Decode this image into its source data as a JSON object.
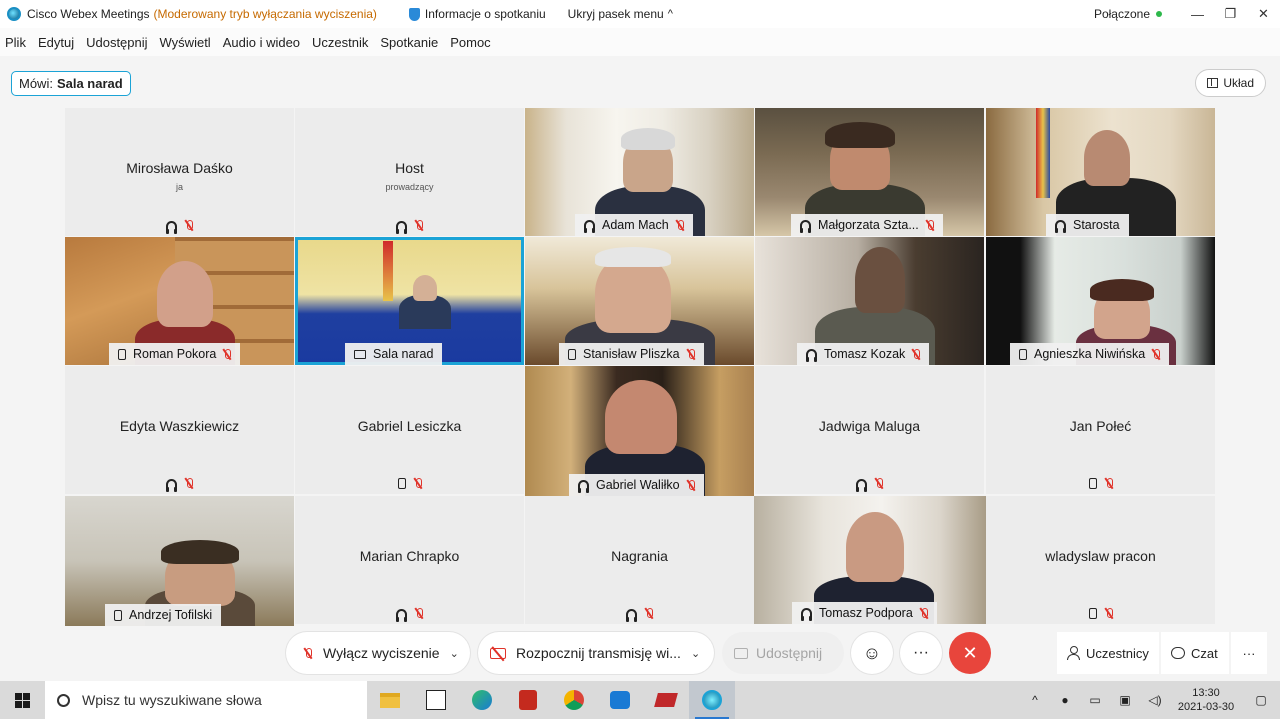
{
  "window": {
    "app_title": "Cisco Webex Meetings",
    "mode": "(Moderowany tryb wyłączania wyciszenia)",
    "meeting_info": "Informacje o spotkaniu",
    "hide_menu": "Ukryj pasek menu",
    "hide_menu_chevron": "^",
    "status": "Połączone",
    "minimize": "—",
    "restore": "❐",
    "close": "✕"
  },
  "menu": [
    "Plik",
    "Edytuj",
    "Udostępnij",
    "Wyświetl",
    "Audio i wideo",
    "Uczestnik",
    "Spotkanie",
    "Pomoc"
  ],
  "speaking": {
    "label": "Mówi:",
    "name": "Sala narad"
  },
  "layout_button": "Układ",
  "participants": [
    {
      "name": "Mirosława Daśko",
      "role": "ja",
      "video": false,
      "audio": "headset"
    },
    {
      "name": "Host",
      "role": "prowadzący",
      "video": false,
      "audio": "headset"
    },
    {
      "name": "Adam Mach",
      "video": true,
      "audio": "headset"
    },
    {
      "name": "Małgorzata Szta...",
      "video": true,
      "audio": "headset"
    },
    {
      "name": "Starosta",
      "video": true,
      "audio": "headset"
    },
    {
      "name": "Roman Pokora",
      "video": true,
      "audio": "phone"
    },
    {
      "name": "Sala narad",
      "video": true,
      "audio": "room",
      "active": true
    },
    {
      "name": "Stanisław Pliszka",
      "video": true,
      "audio": "phone"
    },
    {
      "name": "Tomasz Kozak",
      "video": true,
      "audio": "headset"
    },
    {
      "name": "Agnieszka Niwińska",
      "video": true,
      "audio": "phone"
    },
    {
      "name": "Edyta Waszkiewicz",
      "video": false,
      "audio": "headset"
    },
    {
      "name": "Gabriel Lesiczka",
      "video": false,
      "audio": "phone"
    },
    {
      "name": "Gabriel Waliłko",
      "video": true,
      "audio": "headset"
    },
    {
      "name": "Jadwiga Maluga",
      "video": false,
      "audio": "headset"
    },
    {
      "name": "Jan Połeć",
      "video": false,
      "audio": "phone"
    },
    {
      "name": "Andrzej Tofilski",
      "video": true,
      "audio": "phone"
    },
    {
      "name": "Marian Chrapko",
      "video": false,
      "audio": "headset"
    },
    {
      "name": "Nagrania",
      "video": false,
      "audio": "headset"
    },
    {
      "name": "Tomasz Podpora",
      "video": true,
      "audio": "headset"
    },
    {
      "name": "wladyslaw pracon",
      "video": false,
      "audio": "phone"
    }
  ],
  "controls": {
    "unmute": "Wyłącz wyciszenie",
    "start_video": "Rozpocznij transmisję wi...",
    "share": "Udostępnij",
    "reactions": "☺",
    "more": "···",
    "end": "✕",
    "participants": "Uczestnicy",
    "chat": "Czat",
    "more_right": "···",
    "dropdown": "⌄"
  },
  "taskbar": {
    "search_placeholder": "Wpisz tu wyszukiwane słowa",
    "time": "13:30",
    "date": "2021-03-30",
    "tray_up": "^"
  },
  "colors": {
    "accent": "#1ba3d6",
    "mute_red": "#e0332a",
    "end_red": "#e8453c",
    "connected_green": "#2db84b",
    "mode_orange": "#c66a00"
  }
}
